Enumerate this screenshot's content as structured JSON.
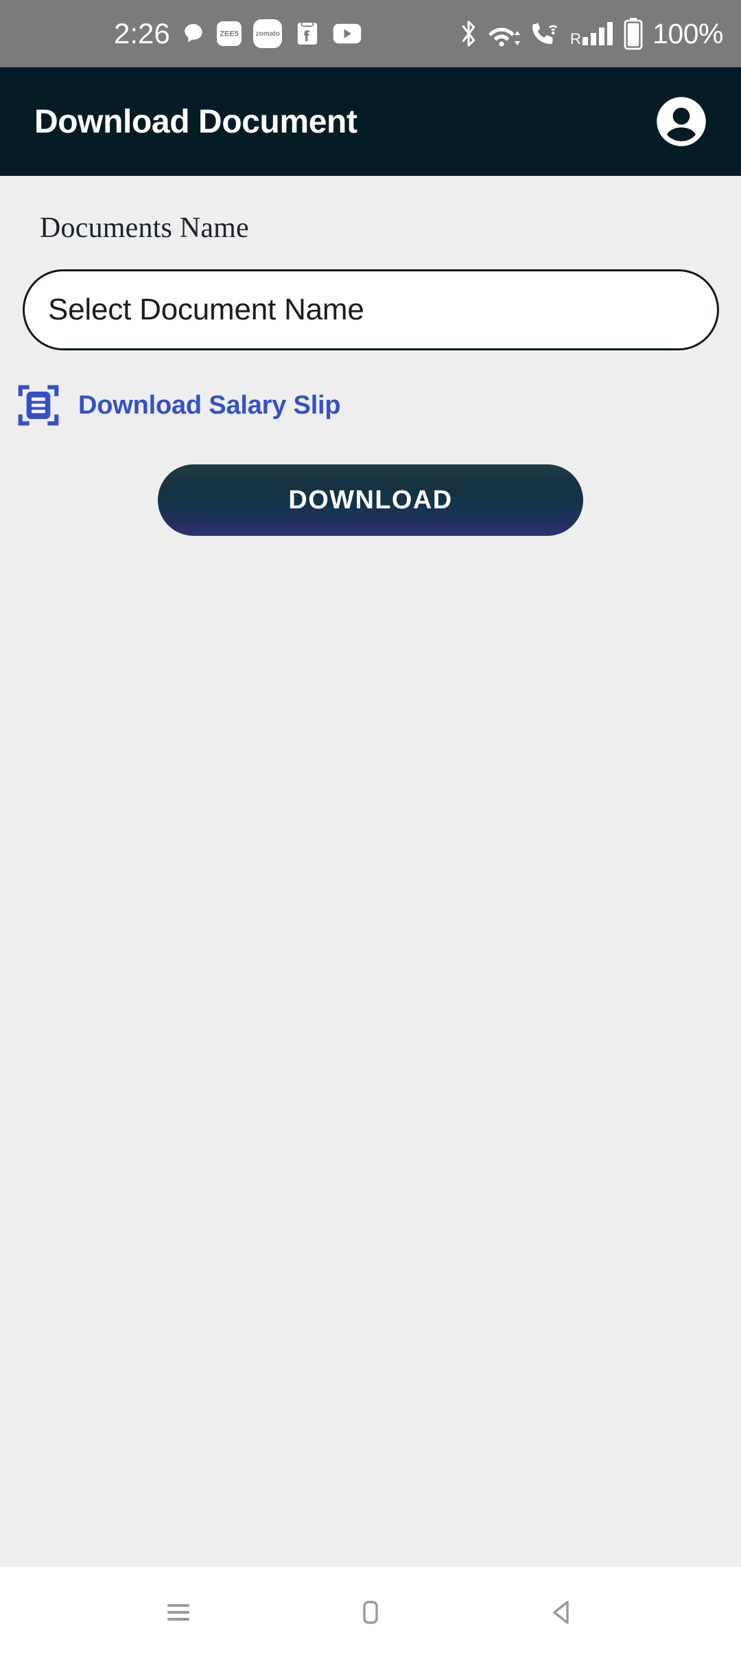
{
  "status_bar": {
    "time": "2:26",
    "battery_percent": "100%",
    "notification_icons": [
      {
        "name": "chat-bubble-icon",
        "label": ""
      },
      {
        "name": "zee5-app-icon",
        "label": "ZEE5"
      },
      {
        "name": "zomato-app-icon",
        "label": "zomato"
      },
      {
        "name": "flipkart-app-icon",
        "label": "f"
      },
      {
        "name": "youtube-app-icon",
        "label": ""
      }
    ],
    "system_icons": [
      {
        "name": "bluetooth-icon"
      },
      {
        "name": "wifi-icon"
      },
      {
        "name": "vowifi-call-icon"
      },
      {
        "name": "roaming-signal-icon",
        "label": "R"
      },
      {
        "name": "battery-icon"
      }
    ],
    "background_color": "#7b7b7b"
  },
  "header": {
    "title": "Download Document",
    "avatar_name": "account-avatar-icon",
    "background_color": "#041c26"
  },
  "form": {
    "documents_name_label": "Documents Name",
    "document_select": {
      "value": "Select Document Name",
      "placeholder": "Select Document Name"
    },
    "salary_slip_link": {
      "label": "Download Salary Slip",
      "icon": "document-scanner-icon",
      "color": "#3451c6"
    },
    "download_button": {
      "label": "DOWNLOAD",
      "gradient_start": "#1e3c47",
      "gradient_end": "#2f3273"
    }
  },
  "nav_bar": {
    "recents_label": "recent-apps",
    "home_label": "home",
    "back_label": "back"
  }
}
